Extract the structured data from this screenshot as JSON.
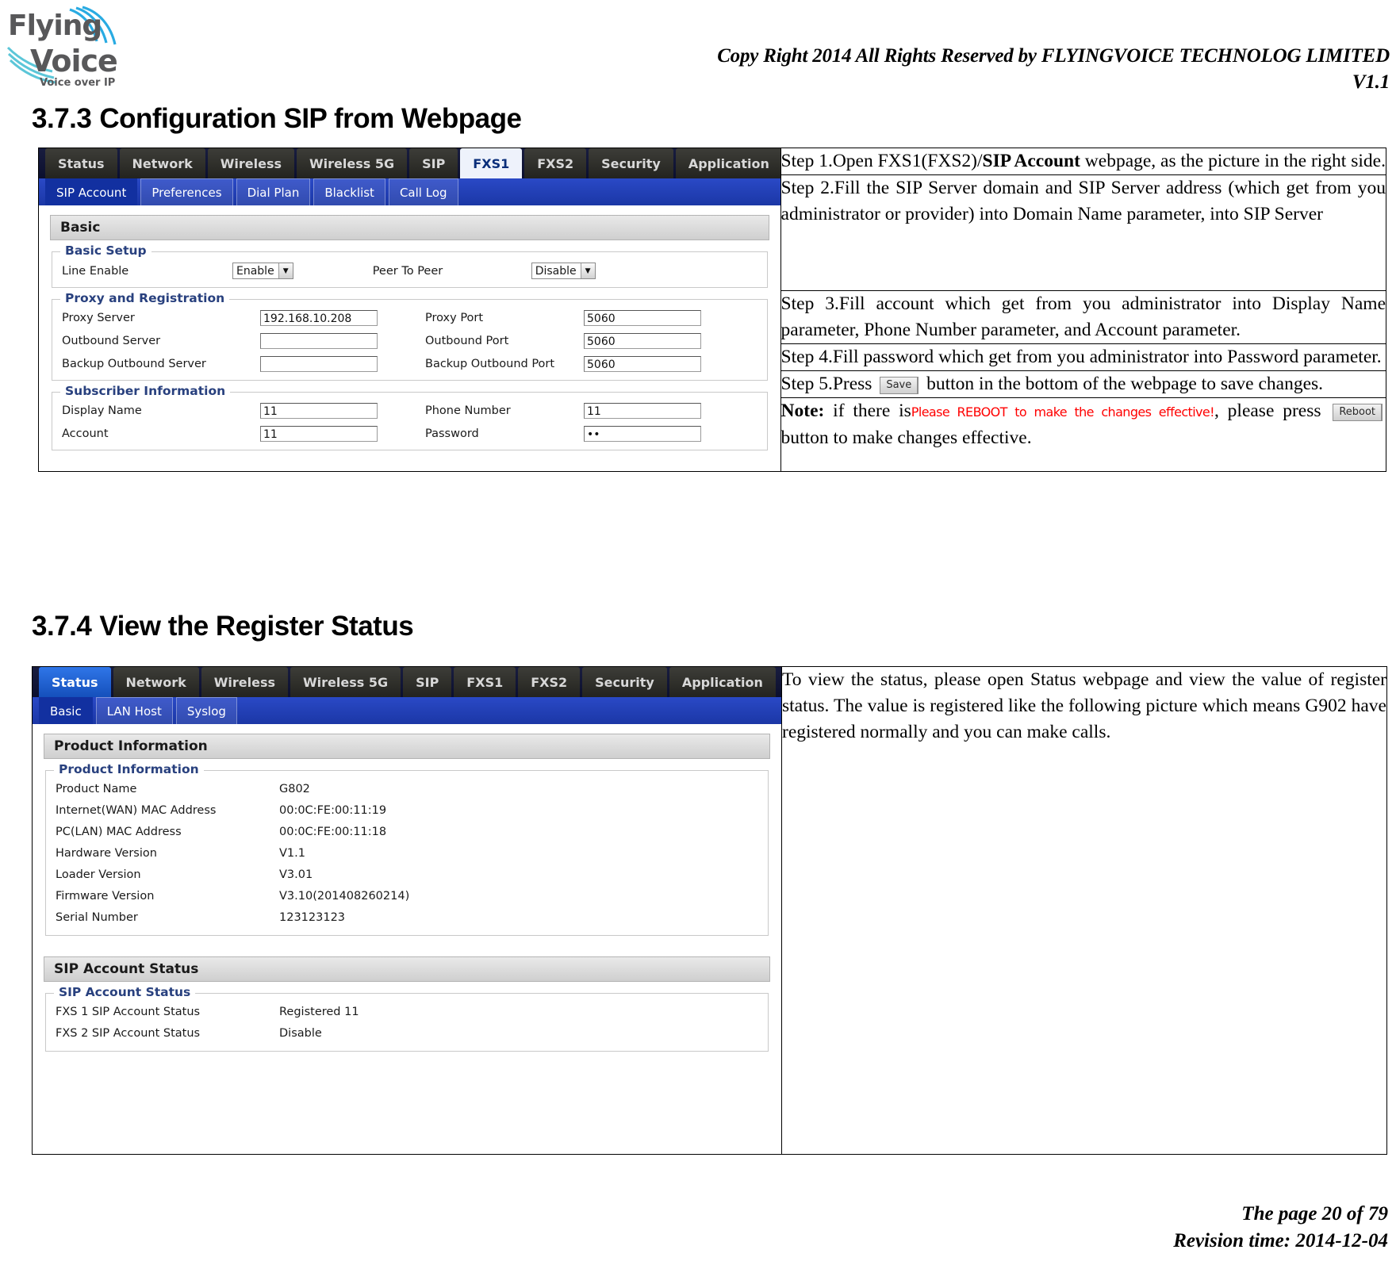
{
  "header": {
    "logo_top": "Flying",
    "logo_bottom": "Voice",
    "logo_tagline": "Voice over IP",
    "copyright": "Copy Right 2014 All Rights Reserved by FLYINGVOICE TECHNOLOG LIMITED",
    "version": "V1.1"
  },
  "sections": [
    {
      "number": "3.7.3",
      "title": "Configuration SIP from Webpage"
    },
    {
      "number": "3.7.4",
      "title": "View the Register Status"
    }
  ],
  "sip_screenshot": {
    "main_tabs": [
      {
        "label": "Status",
        "state": "inactive"
      },
      {
        "label": "Network",
        "state": "inactive"
      },
      {
        "label": "Wireless",
        "state": "inactive"
      },
      {
        "label": "Wireless 5G",
        "state": "inactive"
      },
      {
        "label": "SIP",
        "state": "inactive"
      },
      {
        "label": "FXS1",
        "state": "active"
      },
      {
        "label": "FXS2",
        "state": "inactive"
      },
      {
        "label": "Security",
        "state": "inactive"
      },
      {
        "label": "Application",
        "state": "inactive"
      }
    ],
    "sub_tabs": [
      {
        "label": "SIP Account",
        "state": "active"
      },
      {
        "label": "Preferences",
        "state": "inactive"
      },
      {
        "label": "Dial Plan",
        "state": "inactive"
      },
      {
        "label": "Blacklist",
        "state": "inactive"
      },
      {
        "label": "Call Log",
        "state": "inactive"
      }
    ],
    "panel_title": "Basic",
    "basic_setup": {
      "legend": "Basic Setup",
      "line_enable_label": "Line Enable",
      "line_enable_value": "Enable",
      "peer_to_peer_label": "Peer To Peer",
      "peer_to_peer_value": "Disable"
    },
    "proxy_registration": {
      "legend": "Proxy and Registration",
      "rows": [
        {
          "label": "Proxy Server",
          "value": "192.168.10.208",
          "label2": "Proxy Port",
          "value2": "5060"
        },
        {
          "label": "Outbound Server",
          "value": "",
          "label2": "Outbound Port",
          "value2": "5060"
        },
        {
          "label": "Backup Outbound Server",
          "value": "",
          "label2": "Backup Outbound Port",
          "value2": "5060"
        }
      ]
    },
    "subscriber_information": {
      "legend": "Subscriber Information",
      "rows": [
        {
          "label": "Display Name",
          "value": "11",
          "label2": "Phone Number",
          "value2": "11"
        },
        {
          "label": "Account",
          "value": "11",
          "label2": "Password",
          "value2": "••"
        }
      ]
    }
  },
  "sip_steps": {
    "step1_a": "Step 1.Open FXS1(FXS2)/",
    "step1_bold": "SIP Account",
    "step1_b": " webpage, as the picture in the right side.",
    "step2": "Step 2.Fill the SIP Server domain and SIP Server address (which get from you administrator or provider) into Domain Name parameter, into SIP Server",
    "step3": "Step 3.Fill account which get from you administrator into Display Name parameter, Phone Number parameter, and Account parameter.",
    "step4": "Step 4.Fill password which get from you administrator into Password parameter.",
    "step5_a": "Step 5.Press",
    "step5_button": "Save",
    "step5_b": "button in the bottom of the webpage to save changes.",
    "note_label": "Note:",
    "note_a": "if there is",
    "note_warning": "Please REBOOT to make the changes effective!",
    "note_b": ", please press",
    "note_button": "Reboot",
    "note_c": "button to make changes effective."
  },
  "status_screenshot": {
    "main_tabs": [
      {
        "label": "Status",
        "state": "active-blue"
      },
      {
        "label": "Network",
        "state": "inactive"
      },
      {
        "label": "Wireless",
        "state": "inactive"
      },
      {
        "label": "Wireless 5G",
        "state": "inactive"
      },
      {
        "label": "SIP",
        "state": "inactive"
      },
      {
        "label": "FXS1",
        "state": "inactive"
      },
      {
        "label": "FXS2",
        "state": "inactive"
      },
      {
        "label": "Security",
        "state": "inactive"
      },
      {
        "label": "Application",
        "state": "inactive"
      }
    ],
    "sub_tabs": [
      {
        "label": "Basic",
        "state": "active"
      },
      {
        "label": "LAN Host",
        "state": "inactive"
      },
      {
        "label": "Syslog",
        "state": "inactive"
      }
    ],
    "product_panel_title": "Product Information",
    "product_legend": "Product Information",
    "product_rows": [
      {
        "key": "Product Name",
        "value": "G802"
      },
      {
        "key": "Internet(WAN) MAC Address",
        "value": "00:0C:FE:00:11:19"
      },
      {
        "key": "PC(LAN) MAC Address",
        "value": "00:0C:FE:00:11:18"
      },
      {
        "key": "Hardware Version",
        "value": "V1.1"
      },
      {
        "key": "Loader Version",
        "value": "V3.01"
      },
      {
        "key": "Firmware Version",
        "value": "V3.10(201408260214)"
      },
      {
        "key": "Serial Number",
        "value": "123123123"
      }
    ],
    "sip_panel_title": "SIP Account Status",
    "sip_legend": "SIP Account Status",
    "sip_rows": [
      {
        "key": "FXS 1 SIP Account Status",
        "value": "Registered 11"
      },
      {
        "key": "FXS 2 SIP Account Status",
        "value": "Disable"
      }
    ]
  },
  "status_description": "To view the status, please open Status webpage and view the value of register status. The value is registered like the following picture which means G902 have registered normally and you can make calls.",
  "footer": {
    "page": "The page 20 of 79",
    "revision": "Revision time: 2014-12-04"
  }
}
